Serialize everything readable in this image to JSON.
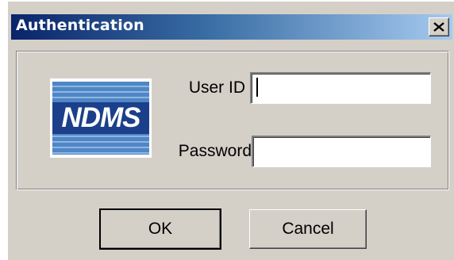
{
  "window": {
    "title": "Authentication",
    "close_label": "×"
  },
  "logo": {
    "text": "NDMS"
  },
  "form": {
    "user_id_label": "User ID",
    "user_id_value": "",
    "password_label": "Password",
    "password_value": ""
  },
  "buttons": {
    "ok_label": "OK",
    "cancel_label": "Cancel"
  },
  "colors": {
    "dialog_face": "#d4d0c8",
    "title_bar_start": "#0a246a",
    "title_bar_end": "#a6caf0",
    "logo_blue": "#1b3f8a"
  },
  "icons": {
    "close": "close-icon"
  }
}
